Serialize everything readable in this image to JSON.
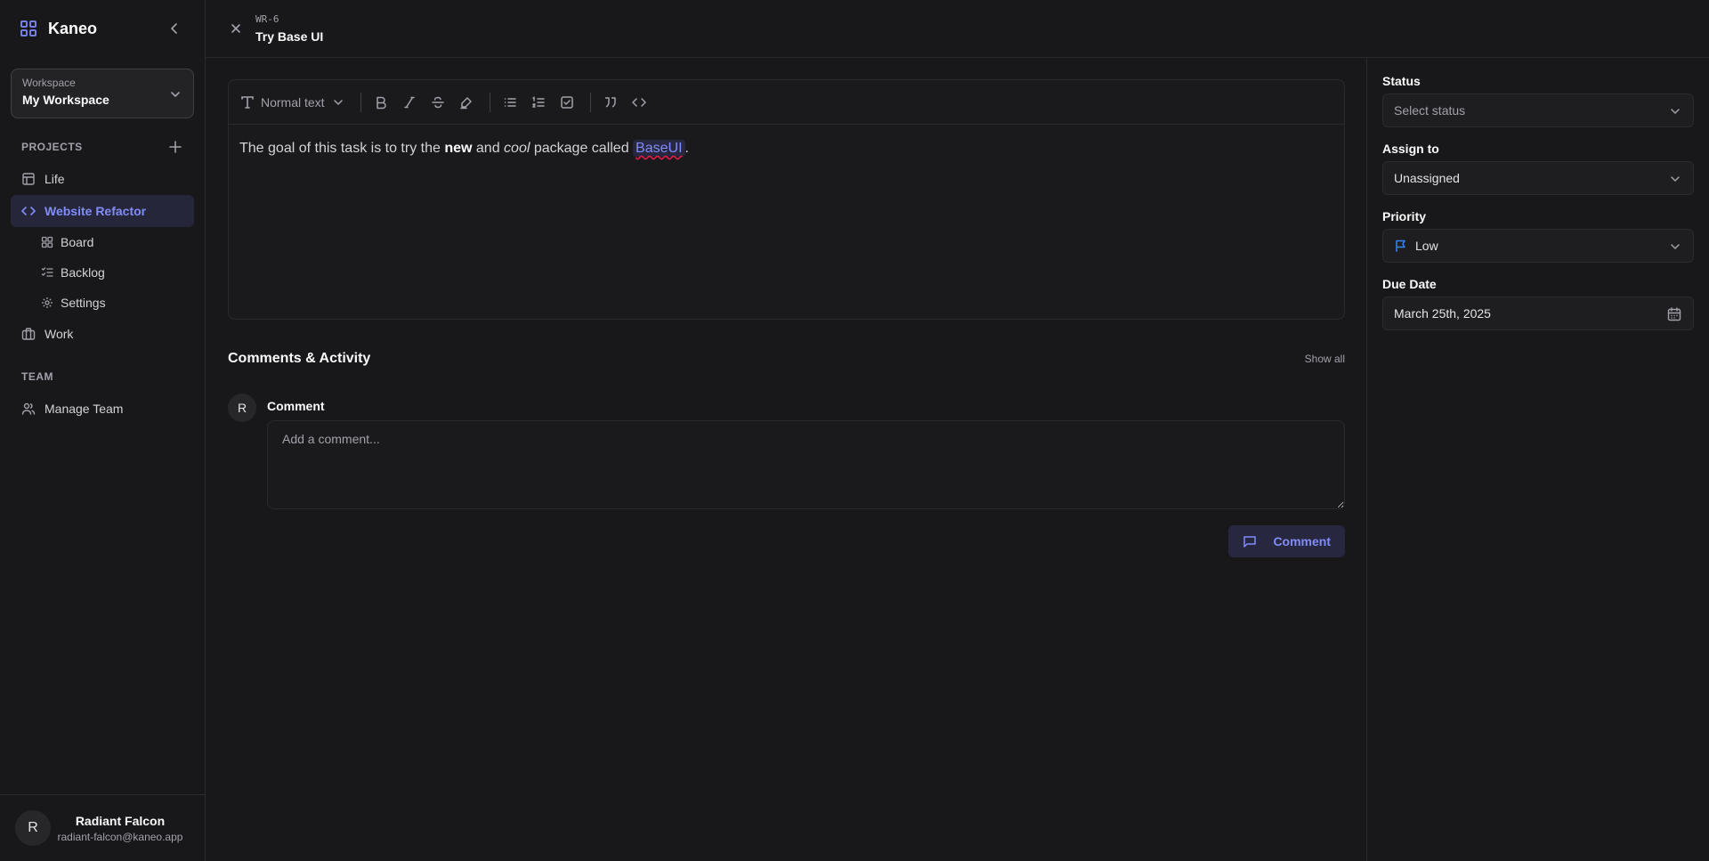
{
  "sidebar": {
    "brand": "Kaneo",
    "workspace": {
      "label": "Workspace",
      "value": "My Workspace"
    },
    "projects_heading": "PROJECTS",
    "projects": [
      {
        "label": "Life",
        "icon": "layout-icon"
      },
      {
        "label": "Website Refactor",
        "icon": "code-icon",
        "active": true,
        "children": [
          "Board",
          "Backlog",
          "Settings"
        ]
      },
      {
        "label": "Work",
        "icon": "briefcase-icon"
      }
    ],
    "team_heading": "TEAM",
    "team": [
      {
        "label": "Manage Team",
        "icon": "users-icon"
      }
    ],
    "user": {
      "initial": "R",
      "name": "Radiant Falcon",
      "email": "radiant-falcon@kaneo.app"
    }
  },
  "task": {
    "id": "WR-6",
    "title": "Try Base UI"
  },
  "editor": {
    "format_label": "Normal text",
    "text_parts": {
      "p1": "The goal of this task is to try the ",
      "b1": "new",
      "p2": " and ",
      "i1": "cool",
      "p3": " package called ",
      "code1": "BaseUI",
      "p4": "."
    }
  },
  "comments": {
    "title": "Comments & Activity",
    "show_all": "Show all",
    "avatar_initial": "R",
    "label": "Comment",
    "placeholder": "Add a comment...",
    "submit": "Comment"
  },
  "details": {
    "status": {
      "label": "Status",
      "value": "Select status"
    },
    "assignee": {
      "label": "Assign to",
      "value": "Unassigned"
    },
    "priority": {
      "label": "Priority",
      "value": "Low",
      "color": "#3b82f6"
    },
    "due": {
      "label": "Due Date",
      "value": "March 25th, 2025"
    }
  },
  "colors": {
    "accent": "#818cf8",
    "background": "#18181b"
  }
}
